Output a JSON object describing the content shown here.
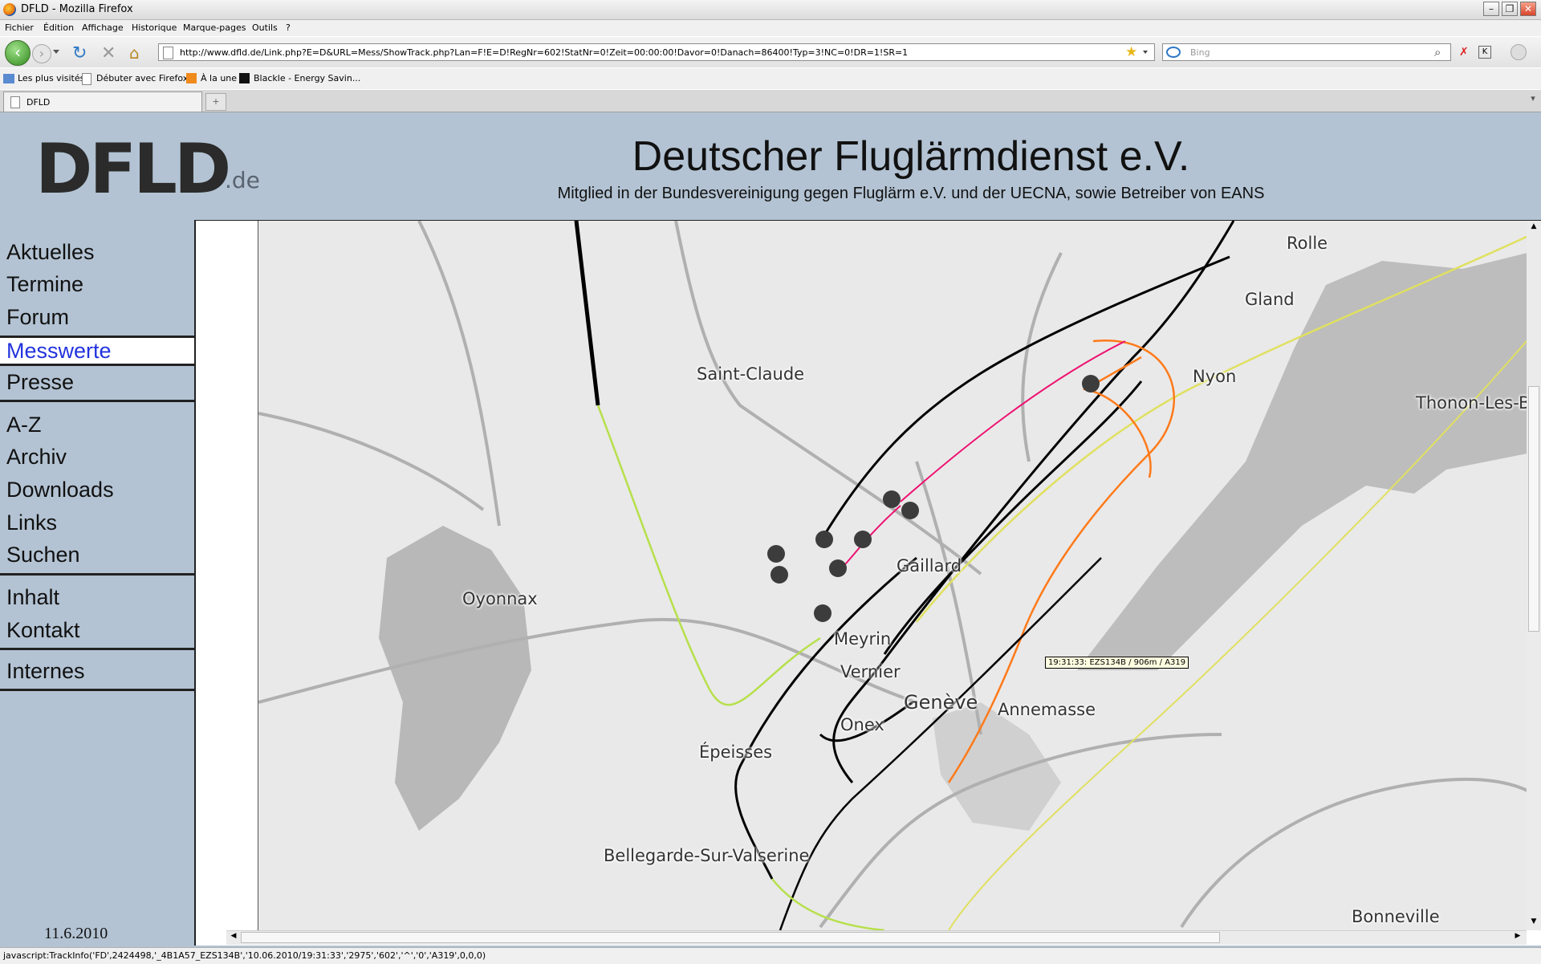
{
  "window": {
    "title": "DFLD - Mozilla Firefox"
  },
  "menu": [
    "Fichier",
    "Édition",
    "Affichage",
    "Historique",
    "Marque-pages",
    "Outils",
    "?"
  ],
  "url": "http://www.dfld.de/Link.php?E=D&URL=Mess/ShowTrack.php?Lan=F!E=D!RegNr=602!StatNr=0!Zeit=00:00:00!Davor=0!Danach=86400!Typ=3!NC=0!DR=1!SR=1",
  "search": {
    "placeholder": "Bing"
  },
  "bookmarks": [
    "Les plus visités",
    "Débuter avec Firefox",
    "À la une",
    "Blackle - Energy Savin..."
  ],
  "tab": {
    "label": "DFLD"
  },
  "site": {
    "logo": "DFLD",
    "logo_suffix": ".de",
    "title": "Deutscher Fluglärmdienst e.V.",
    "subtitle": "Mitglied in der Bundesvereinigung gegen Fluglärm e.V. und der UECNA, sowie Betreiber von EANS",
    "date": "11.6.2010"
  },
  "nav": [
    "Aktuelles",
    "Termine",
    "Forum",
    "Messwerte",
    "Presse",
    "A-Z",
    "Archiv",
    "Downloads",
    "Links",
    "Suchen",
    "Inhalt",
    "Kontakt",
    "Internes"
  ],
  "nav_active": "Messwerte",
  "map": {
    "places": [
      "Rolle",
      "Gland",
      "Nyon",
      "Saint-Claude",
      "Thonon-Les-Ba",
      "Oyonnax",
      "Gaillard",
      "Meyrin",
      "Vernier",
      "Genève",
      "Annemasse",
      "Onex",
      "Épeisses",
      "Bellegarde-Sur-Valserine",
      "Bonneville"
    ],
    "tooltip": "19:31:33: EZS134B / 906m / A319"
  },
  "status": "javascript:TrackInfo('FD',2424498,'_4B1A57_EZS134B','10.06.2010/19:31:33','2975','602','^','0','A319',0,0,0)",
  "colors": {
    "sidebar_bg": "#b3c3d3",
    "active_nav": "#2233dd"
  }
}
